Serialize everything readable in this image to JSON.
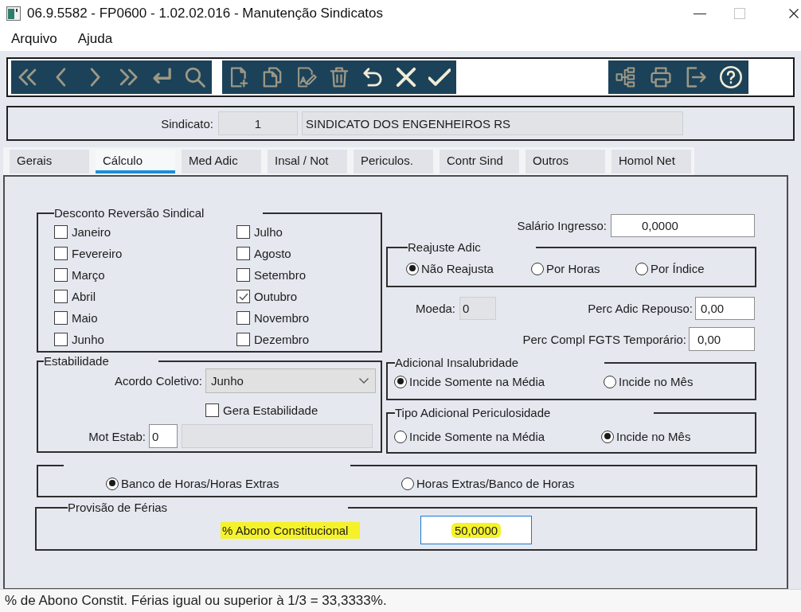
{
  "window": {
    "title": "06.9.5582 - FP0600 - 1.02.02.016 - Manutenção Sindicatos"
  },
  "menu": [
    "Arquivo",
    "Ajuda"
  ],
  "toolbar": {
    "groups": [
      {
        "buttons": [
          {
            "disabled": true
          },
          {
            "disabled": true
          },
          {
            "disabled": true
          },
          {
            "disabled": true
          },
          {
            "disabled": true
          },
          {
            "disabled": true
          }
        ]
      },
      {
        "buttons": [
          {
            "disabled": true
          },
          {
            "disabled": true
          },
          {
            "disabled": true
          },
          {
            "disabled": true
          },
          {
            "disabled": false
          },
          {
            "disabled": false
          },
          {
            "disabled": false
          }
        ]
      },
      {
        "buttons": [
          {
            "disabled": true
          },
          {
            "disabled": true
          },
          {
            "disabled": true
          },
          {
            "disabled": false
          }
        ]
      }
    ]
  },
  "header": {
    "label": "Sindicato:",
    "code": {
      "value": "1",
      "disabled": true
    },
    "name": {
      "value": "SINDICATO DOS ENGENHEIROS RS",
      "disabled": true
    }
  },
  "tabs": [
    {
      "label": "Gerais",
      "selected": false
    },
    {
      "label": "Cálculo",
      "selected": true
    },
    {
      "label": "Med Adic",
      "selected": false
    },
    {
      "label": "Insal / Not",
      "selected": false
    },
    {
      "label": "Periculos.",
      "selected": false
    },
    {
      "label": "Contr Sind",
      "selected": false
    },
    {
      "label": "Outros",
      "selected": false
    },
    {
      "label": "Homol Net",
      "selected": false
    }
  ],
  "desconto_reversao_sindical": {
    "title": "Desconto Reversão Sindical",
    "months": [
      {
        "label": "Janeiro",
        "checked": false
      },
      {
        "label": "Fevereiro",
        "checked": false
      },
      {
        "label": "Março",
        "checked": false
      },
      {
        "label": "Abril",
        "checked": false
      },
      {
        "label": "Maio",
        "checked": false
      },
      {
        "label": "Junho",
        "checked": false
      },
      {
        "label": "Julho",
        "checked": false
      },
      {
        "label": "Agosto",
        "checked": false
      },
      {
        "label": "Setembro",
        "checked": false
      },
      {
        "label": "Outubro",
        "checked": true
      },
      {
        "label": "Novembro",
        "checked": false
      },
      {
        "label": "Dezembro",
        "checked": false
      }
    ]
  },
  "estabilidade": {
    "title": "Estabilidade",
    "acordo_coletivo": {
      "label": "Acordo Coletivo:",
      "value": "Junho"
    },
    "gera_estabilidade": {
      "label": "Gera Estabilidade",
      "checked": false
    },
    "mot_estab": {
      "label": "Mot Estab:",
      "value": "0"
    }
  },
  "salario_ingresso": {
    "label": "Salário Ingresso:",
    "value": "0,0000"
  },
  "reajuste_adic": {
    "title": "Reajuste Adic",
    "options": [
      {
        "label": "Não Reajusta",
        "selected": true
      },
      {
        "label": "Por Horas",
        "selected": false
      },
      {
        "label": "Por Índice",
        "selected": false
      }
    ]
  },
  "moeda": {
    "label": "Moeda:",
    "value": "0",
    "disabled": true
  },
  "perc_adic_repouso": {
    "label": "Perc Adic Repouso:",
    "value": "0,00"
  },
  "perc_compl_fgts_temporario": {
    "label": "Perc Compl FGTS Temporário:",
    "value": "0,00"
  },
  "adicional_insalubridade": {
    "title": "Adicional Insalubridade",
    "options": [
      {
        "label": "Incide Somente na Média",
        "selected": true
      },
      {
        "label": "Incide no Mês",
        "selected": false
      }
    ]
  },
  "tipo_adicional_periculosidade": {
    "title": "Tipo Adicional Periculosidade",
    "options": [
      {
        "label": "Incide Somente na Média",
        "selected": false
      },
      {
        "label": "Incide no Mês",
        "selected": true
      }
    ]
  },
  "banco_horas": {
    "options": [
      {
        "label": "Banco de Horas/Horas Extras",
        "selected": true
      },
      {
        "label": "Horas Extras/Banco de Horas",
        "selected": false
      }
    ]
  },
  "provisao_ferias": {
    "title": "Provisão de Férias",
    "label": {
      "text": "% Abono Constitucional",
      "highlighted": true
    },
    "field": {
      "value": "50,0000",
      "focused": true,
      "highlighted": true
    }
  },
  "status_bar": "% de Abono Constit. Férias igual ou superior à 1/3 = 33,3333%."
}
